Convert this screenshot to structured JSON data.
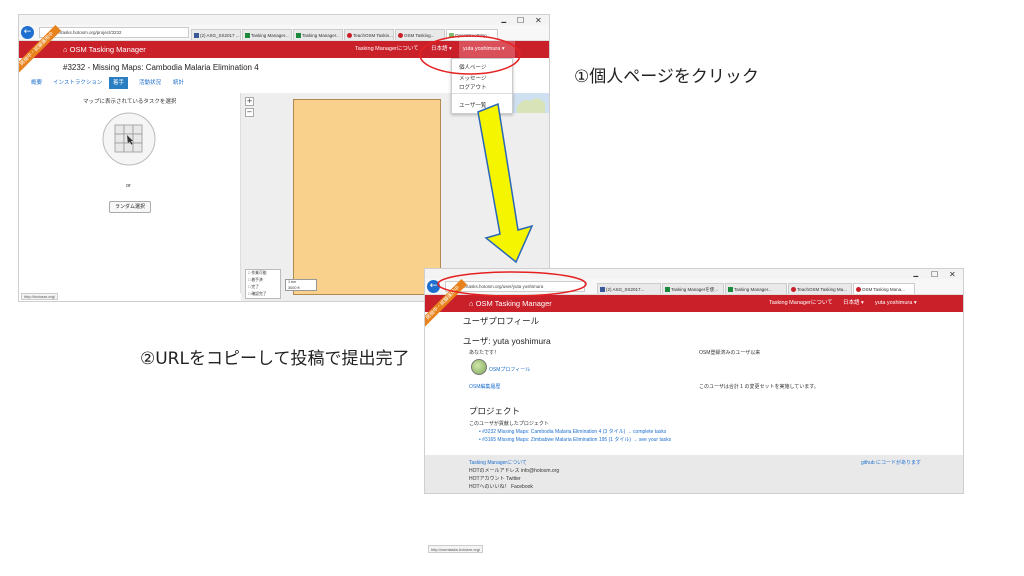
{
  "annotations": {
    "step1": "①個人ページをクリック",
    "step2": "②URLをコピーして投稿で提出完了"
  },
  "colors": {
    "nav_red": "#c9202a",
    "ribbon_orange": "#e8821c",
    "highlight_red": "#e52222",
    "arrow_yellow": "#f5f500",
    "task_area": "#f9d08c"
  },
  "screenshot1": {
    "window_controls": [
      "🗕",
      "☐",
      "✕"
    ],
    "address": "http://tasks.hotosm.org/project/3232",
    "tabs": [
      {
        "label": "(2) ASG_SS2017 ...",
        "icon": "facebook-icon"
      },
      {
        "label": "Tasking Manager...",
        "icon": "sheet-icon"
      },
      {
        "label": "Tasking Manager...",
        "icon": "sheet-icon"
      },
      {
        "label": "TeachOSM Taskin...",
        "icon": "osm-icon"
      },
      {
        "label": "OSM Tasking...",
        "icon": "osm-icon"
      },
      {
        "label": "OpenStreetMap",
        "icon": "map-icon"
      }
    ],
    "brand": "OSM Tasking Manager",
    "nav_about": "Tasking Managerについて",
    "nav_language": "日本語 ▾",
    "nav_user": "yuta yoshimura ▾",
    "ribbon": "開発中・試験運用中",
    "project_title": "#3232 - Missing Maps: Cambodia Malaria Elimination 4",
    "subtabs": [
      "概要",
      "インストラクション",
      "着手",
      "活動状況",
      "統計"
    ],
    "active_subtab": "着手",
    "select_prompt": "マップに表示されているタスクを選択",
    "or_text": "or",
    "random_button": "ランダム選択",
    "zoom_in": "+",
    "zoom_out": "−",
    "legend": [
      "作業可能",
      "着手済",
      "完了",
      "確認完了"
    ],
    "scale": [
      "1 km",
      "3000 ft"
    ],
    "status_url": "http://hotosm.org/",
    "dropdown_items": [
      "個人ページ",
      "メッセージ",
      "ログアウト",
      "ユーザ一覧"
    ]
  },
  "screenshot2": {
    "window_controls": [
      "🗕",
      "☐",
      "✕"
    ],
    "address": "http://tasks.hotosm.org/user/yuta yoshimura",
    "tabs": [
      {
        "label": "(2) ASG_SS2017...",
        "icon": "facebook-icon"
      },
      {
        "label": "Tasking Managerを使...",
        "icon": "sheet-icon"
      },
      {
        "label": "Tasking Manager...",
        "icon": "sheet-icon"
      },
      {
        "label": "TeachOSM Tasking Ma...",
        "icon": "osm-icon"
      },
      {
        "label": "OSM Tasking Mana...",
        "icon": "osm-icon"
      }
    ],
    "brand": "OSM Tasking Manager",
    "nav_about": "Tasking Managerについて",
    "nav_language": "日本語 ▾",
    "nav_user": "yuta yoshimura ▾",
    "ribbon": "開発中・試験運用中",
    "page_title": "ユーザプロフィール",
    "user_heading": "ユーザ: yuta yoshimura",
    "you_label": "あなたです！",
    "osm_profile_link": "OSMプロフィール",
    "osm_history_link": "OSM編集履歴",
    "osm_signup": "OSM登録済みのユーザ以来",
    "changesets": "このユーザは合計 1 の変更セットを実施しています。",
    "projects_heading": "プロジェクト",
    "projects_intro": "このユーザが貢献したプロジェクト",
    "projects": [
      {
        "text": "#3232 Missing Maps: Cambodia Malaria Elimination 4 (3 タイル)",
        "sub": "→ complete tasks"
      },
      {
        "text": "#3165 Missing Maps: Zimbabwe Malaria Elimination 195 (1 タイル)",
        "sub": "→ see your tasks"
      }
    ],
    "footer_lines": [
      "Tasking Managerについて",
      "HOTのメールアドレス info@hotosm.org",
      "HOTアカウント Twitter",
      "HOTへのいいね！ Facebook"
    ],
    "footer_right": "github にコードがあります"
  },
  "bottom_status_url": "http://osmtasks.hotosm.org/"
}
